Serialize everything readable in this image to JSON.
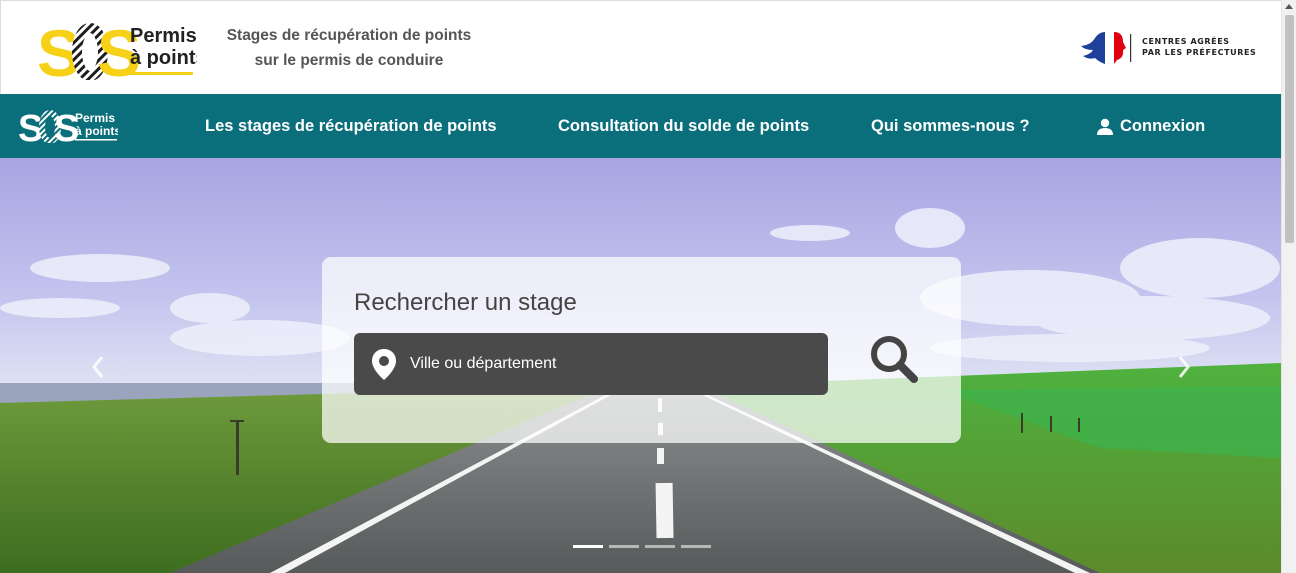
{
  "header": {
    "logo": {
      "mark": "SOS",
      "line1": "Permis",
      "line2": "à points"
    },
    "tagline_line1": "Stages de récupération de points",
    "tagline_line2": "sur le permis de conduire",
    "prefecture_line1": "CENTRES AGRÉES",
    "prefecture_line2": "PAR LES PRÉFECTURES"
  },
  "nav": {
    "logo": {
      "mark": "SOS",
      "line1": "Permis",
      "line2": "à points"
    },
    "items": [
      {
        "label": "Les stages de récupération de points"
      },
      {
        "label": "Consultation du solde de points"
      },
      {
        "label": "Qui sommes-nous ?"
      },
      {
        "label": "Connexion",
        "icon": "user-icon"
      }
    ]
  },
  "hero": {
    "search": {
      "title": "Rechercher un stage",
      "placeholder": "Ville ou département",
      "value": ""
    },
    "slides": 4,
    "active_slide": 1
  },
  "colors": {
    "brand_yellow": "#f7d117",
    "nav_teal": "#0b6f7b",
    "search_field": "#4a4a4a"
  }
}
